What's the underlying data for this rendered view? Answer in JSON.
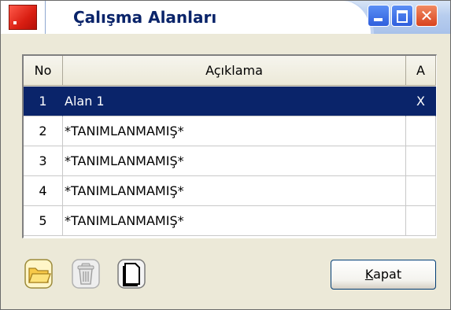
{
  "window": {
    "title": "Çalışma Alanları",
    "close_glyph": "✕"
  },
  "grid": {
    "columns": [
      "No",
      "Açıklama",
      "A"
    ],
    "rows": [
      {
        "no": "1",
        "desc": "Alan 1",
        "a": "X",
        "selected": true
      },
      {
        "no": "2",
        "desc": "*TANIMLANMAMIŞ*",
        "a": ""
      },
      {
        "no": "3",
        "desc": "*TANIMLANMAMIŞ*",
        "a": ""
      },
      {
        "no": "4",
        "desc": "*TANIMLANMAMIŞ*",
        "a": ""
      },
      {
        "no": "5",
        "desc": "*TANIMLANMAMIŞ*",
        "a": ""
      }
    ]
  },
  "toolbar": {
    "open_icon": "folder-open-icon",
    "delete_icon": "trash-icon",
    "new_icon": "new-document-icon",
    "close_label_underlined": "K",
    "close_label_rest": "apat"
  },
  "colors": {
    "selection": "#0a246a",
    "title_text": "#0a246a",
    "window_bg": "#ece9d8"
  }
}
